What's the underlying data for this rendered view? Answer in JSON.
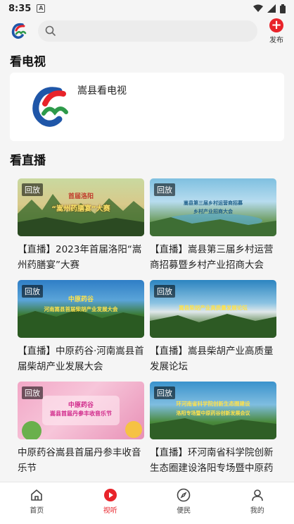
{
  "status_bar": {
    "time": "8:35",
    "notification_badge": "A"
  },
  "top_bar": {
    "search_placeholder": "",
    "publish_label": "发布"
  },
  "tv_section": {
    "title": "看电视",
    "channel_name": "嵩县看电视"
  },
  "live_section": {
    "title": "看直播",
    "items": [
      {
        "badge": "回放",
        "thumb_title": "首届洛阳",
        "thumb_subtitle": "“嵩州药膳宴”大赛",
        "caption": "【直播】2023年首届洛阳“嵩州药膳宴”大赛"
      },
      {
        "badge": "回放",
        "thumb_title": "嵩县第三届乡村运营商招募",
        "thumb_subtitle": "乡村产业招商大会",
        "caption": "【直播】嵩县第三届乡村运营商招募暨乡村产业招商大会"
      },
      {
        "badge": "回放",
        "thumb_title": "中原药谷",
        "thumb_subtitle": "河南嵩县首届柴胡产业发展大会",
        "caption": "【直播】中原药谷·河南嵩县首届柴胡产业发展大会"
      },
      {
        "badge": "回放",
        "thumb_title": "嵩县柴胡产业高质量发展论坛",
        "thumb_subtitle": "",
        "caption": "【直播】嵩县柴胡产业高质量发展论坛"
      },
      {
        "badge": "回放",
        "thumb_title": "中原药谷",
        "thumb_subtitle": "嵩县首届丹参丰收音乐节",
        "caption": "中原药谷嵩县首届丹参丰收音乐节"
      },
      {
        "badge": "回放",
        "thumb_title": "环河南省科学院创新生态圈建设",
        "thumb_subtitle": "洛阳专场暨中原药谷创新发展会议",
        "caption": "【直播】环河南省科学院创新生态圈建设洛阳专场暨中原药谷创新发展会议"
      }
    ]
  },
  "tab_bar": {
    "tabs": [
      {
        "label": "首页",
        "icon": "home-icon"
      },
      {
        "label": "视听",
        "icon": "play-icon"
      },
      {
        "label": "便民",
        "icon": "compass-icon"
      },
      {
        "label": "我的",
        "icon": "user-icon"
      }
    ],
    "active_index": 1,
    "accent_color": "#e8232a"
  }
}
